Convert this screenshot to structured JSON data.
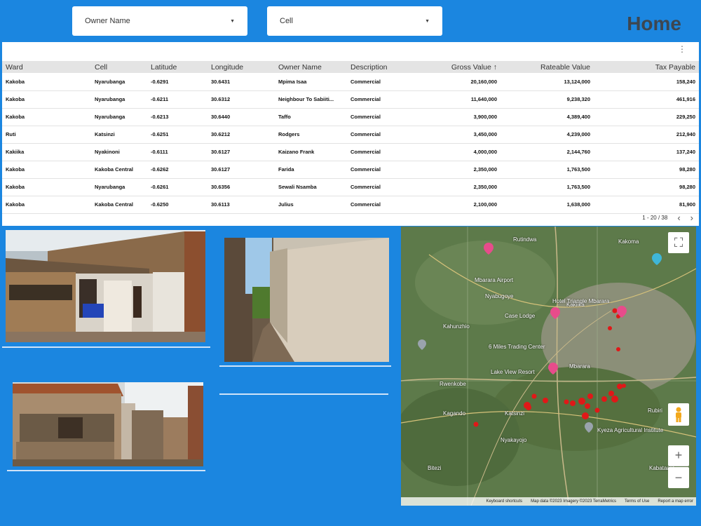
{
  "filters": {
    "owner_name": {
      "label": "Owner Name"
    },
    "cell": {
      "label": "Cell"
    }
  },
  "page_title": "Home",
  "table": {
    "columns": [
      "Ward",
      "Cell",
      "Latitude",
      "Longitude",
      "Owner Name",
      "Description",
      "Gross Value",
      "Rateable Value",
      "Tax Payable"
    ],
    "sort_indicator": "↑",
    "rows": [
      [
        "Kakoba",
        "Nyarubanga",
        "-0.6291",
        "30.6431",
        "Mpima Isaa",
        "Commercial",
        "20,160,000",
        "13,124,000",
        "158,240"
      ],
      [
        "Kakoba",
        "Nyarubanga",
        "-0.6211",
        "30.6312",
        "Neighbour To Sabiiti...",
        "Commercial",
        "11,640,000",
        "9,238,320",
        "461,916"
      ],
      [
        "Kakoba",
        "Nyarubanga",
        "-0.6213",
        "30.6440",
        "Taffo",
        "Commercial",
        "3,900,000",
        "4,389,400",
        "229,250"
      ],
      [
        "Ruti",
        "Katsinzi",
        "-0.6251",
        "30.6212",
        "Rodgers",
        "Commercial",
        "3,450,000",
        "4,239,000",
        "212,940"
      ],
      [
        "Kakiika",
        "Nyakinoni",
        "-0.6111",
        "30.6127",
        "Kaizano Frank",
        "Commercial",
        "4,000,000",
        "2,144,760",
        "137,240"
      ],
      [
        "Kakoba",
        "Kakoba Central",
        "-0.6262",
        "30.6127",
        "Farida",
        "Commercial",
        "2,350,000",
        "1,763,500",
        "98,280"
      ],
      [
        "Kakoba",
        "Nyarubanga",
        "-0.6261",
        "30.6356",
        "Sewali Nsamba",
        "Commercial",
        "2,350,000",
        "1,763,500",
        "98,280"
      ],
      [
        "Kakoba",
        "Kakoba Central",
        "-0.6250",
        "30.6113",
        "Julius",
        "Commercial",
        "2,100,000",
        "1,638,000",
        "81,900"
      ]
    ],
    "pagination": {
      "range": "1 - 20 / 38"
    }
  },
  "map": {
    "places": [
      "Rutindwa",
      "Kakoma",
      "Mbarara Airport",
      "Kakiika",
      "Nyabugoye",
      "Kahunzhio",
      "Case Lodge",
      "Hotel Triangle Mbarara",
      "6 Miles Trading Center",
      "Lake View Resort",
      "Mbarara",
      "Rwenkobe",
      "Kagando",
      "Katsinzi",
      "Nyakayojo",
      "Kyeza Agricultural Institute",
      "Rubiri",
      "Bitezi",
      "Kabataara"
    ],
    "footer": [
      "Keyboard shortcuts",
      "Map data ©2023 Imagery ©2023 TerraMetrics",
      "Terms of Use",
      "Report a map error"
    ],
    "markers_color": "#e01818"
  },
  "colors": {
    "background": "#1b86e0",
    "header_row": "#e4e4e4",
    "title": "#3d4650"
  }
}
